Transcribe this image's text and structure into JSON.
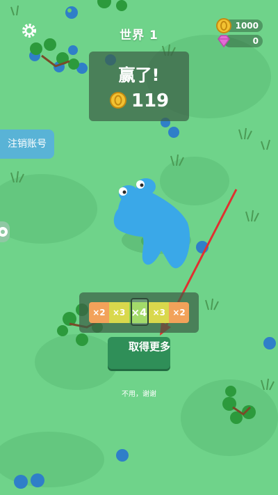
{
  "hud": {
    "world_label": "世界 1",
    "coins": "1000",
    "gems": "0"
  },
  "side": {
    "logout_label": "注销账号"
  },
  "result": {
    "title": "赢了!",
    "reward": "119"
  },
  "multiplier": {
    "segments": [
      "×2",
      "×3",
      "×4",
      "×3",
      "×2"
    ],
    "selected_index": 2,
    "colors": [
      "#f2a25a",
      "#d9d84c",
      "#8fd24a",
      "#d9d84c",
      "#f2a25a"
    ]
  },
  "actions": {
    "get_more_label": "取得更多",
    "no_thanks_label": "不用，谢谢"
  },
  "colors": {
    "grass": "#6fd38a",
    "panel": "#3c5f46",
    "button": "#2f8f58",
    "monster": "#3aa8e8",
    "arrow": "#e03030"
  }
}
